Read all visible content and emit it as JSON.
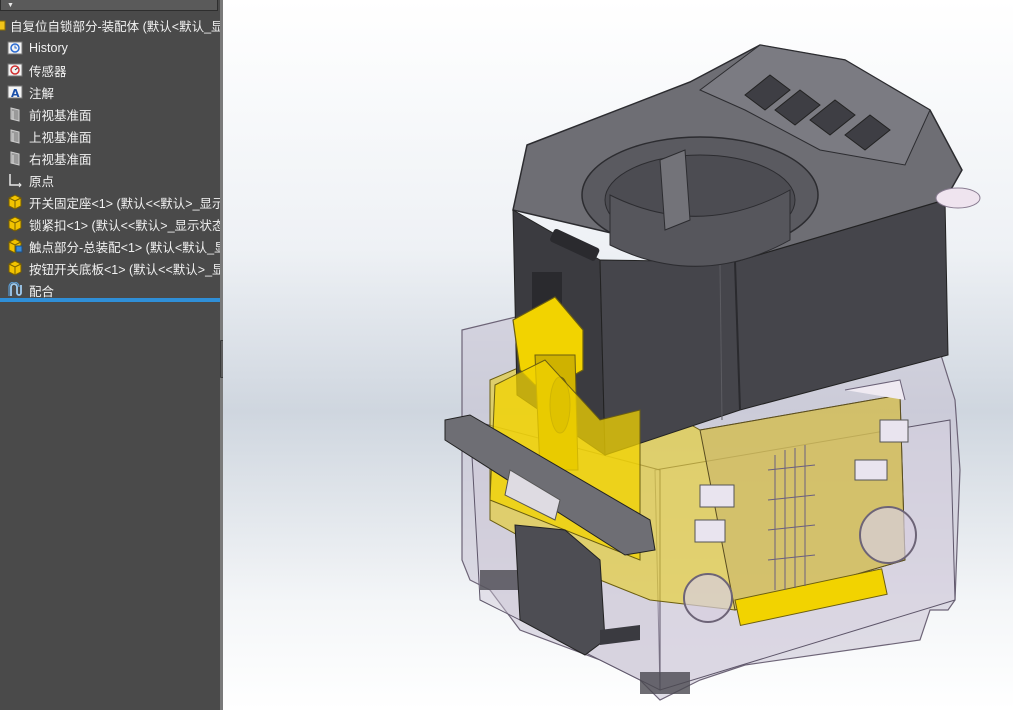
{
  "tree": {
    "root_label": "自复位自锁部分-装配体  (默认<默认_显示",
    "items": [
      {
        "label": "History",
        "icon": "history-icon"
      },
      {
        "label": "传感器",
        "icon": "sensor-icon"
      },
      {
        "label": "注解",
        "icon": "annotation-icon"
      },
      {
        "label": "前视基准面",
        "icon": "plane-icon"
      },
      {
        "label": "上视基准面",
        "icon": "plane-icon"
      },
      {
        "label": "右视基准面",
        "icon": "plane-icon"
      },
      {
        "label": "原点",
        "icon": "origin-icon"
      },
      {
        "label": "开关固定座<1> (默认<<默认>_显示",
        "icon": "part-icon"
      },
      {
        "label": "锁紧扣<1> (默认<<默认>_显示状态",
        "icon": "part-icon"
      },
      {
        "label": "触点部分-总装配<1> (默认<默认_显",
        "icon": "subassembly-icon"
      },
      {
        "label": "按钮开关底板<1> (默认<<默认>_显",
        "icon": "part-icon"
      },
      {
        "label": "配合",
        "icon": "mates-icon"
      }
    ]
  },
  "colors": {
    "panel_bg": "#4a4a4a",
    "selection_accent": "#2f8fd8",
    "part_yellow": "#f2d300",
    "part_dark": "#4a4a4e"
  }
}
